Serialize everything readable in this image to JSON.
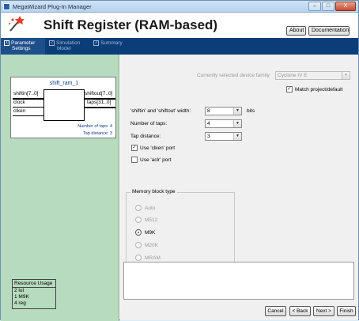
{
  "window": {
    "title": "MegaWizard Plug-In Manager",
    "controls": {
      "minimize": "–",
      "maximize": "□",
      "close": "X"
    }
  },
  "header": {
    "title": "Shift Register (RAM-based)",
    "about_label": "About",
    "documentation_label": "Documentation"
  },
  "steps": [
    {
      "num": "1",
      "line1": "Parameter",
      "line2": "Settings",
      "active": true
    },
    {
      "num": "2",
      "line1": "Simulation",
      "line2": "Model",
      "active": false
    },
    {
      "num": "3",
      "line1": "Summary",
      "line2": "",
      "active": false
    }
  ],
  "symbol": {
    "instance_name": "shift_ram_1",
    "pins": {
      "shiftin": "shiftin[7..0]",
      "clock": "clock",
      "clken": "clken",
      "shiftout": "shiftout[7..0]",
      "taps": "taps[31..0]"
    },
    "info_taps": "Number of taps: 4",
    "info_distance": "Tap distance: 3"
  },
  "resource": {
    "title": "Resource Usage",
    "lines": [
      "2 lut",
      "1 M9K",
      "4 reg"
    ]
  },
  "form": {
    "device_family_label": "Currently selected device family:",
    "device_family_value": "Cyclone IV E",
    "match_project_label": "Match project/default",
    "match_project_checked": true,
    "width_label": "'shiftin' and 'shiftout' width:",
    "width_value": "8",
    "width_unit": "bits",
    "taps_label": "Number of taps:",
    "taps_value": "4",
    "tap_distance_label": "Tap distance:",
    "tap_distance_value": "3",
    "use_clken_label": "Use 'clken' port",
    "use_clken_checked": true,
    "use_aclr_label": "Use 'aclr' port",
    "use_aclr_checked": false,
    "memory_block_title": "Memory block type",
    "memory_options": [
      {
        "label": "Auto",
        "selected": false,
        "enabled": false
      },
      {
        "label": "M512",
        "selected": false,
        "enabled": false
      },
      {
        "label": "M9K",
        "selected": true,
        "enabled": true
      },
      {
        "label": "M20K",
        "selected": false,
        "enabled": false
      },
      {
        "label": "MRAM",
        "selected": false,
        "enabled": false
      }
    ]
  },
  "buttons": {
    "cancel": "Cancel",
    "back": "< Back",
    "next": "Next >",
    "finish": "Finish"
  }
}
